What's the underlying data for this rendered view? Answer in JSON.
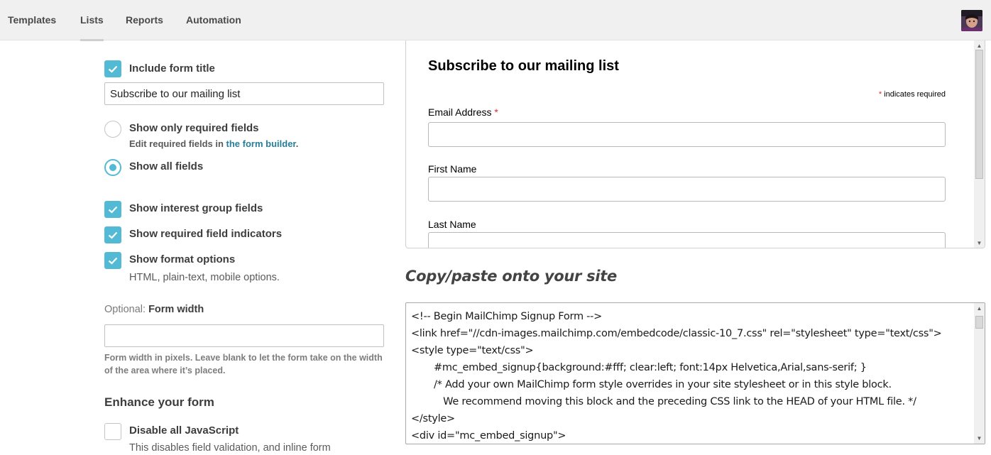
{
  "nav": {
    "tabs": [
      "Templates",
      "Lists",
      "Reports",
      "Automation"
    ],
    "active_tab": "Lists"
  },
  "left": {
    "include_form_title": {
      "label": "Include form title",
      "checked": true,
      "value": "Subscribe to our mailing list"
    },
    "required_only": {
      "label": "Show only required fields",
      "selected": false,
      "help_prefix": "Edit required fields in ",
      "help_link": "the form builder",
      "help_suffix": "."
    },
    "all_fields": {
      "label": "Show all fields",
      "selected": true
    },
    "interest_groups": {
      "label": "Show interest group fields",
      "checked": true
    },
    "required_indicators": {
      "label": "Show required field indicators",
      "checked": true
    },
    "format_options": {
      "label": "Show format options",
      "checked": true,
      "sub": "HTML, plain-text, mobile options."
    },
    "form_width": {
      "prefix": "Optional: ",
      "label": "Form width",
      "value": "",
      "help": "Form width in pixels. Leave blank to let the form take on the width of the area where it’s placed."
    },
    "enhance": {
      "heading": "Enhance your form"
    },
    "disable_js": {
      "label": "Disable all JavaScript",
      "checked": false,
      "sub": "This disables field validation, and inline form"
    }
  },
  "preview": {
    "title": "Subscribe to our mailing list",
    "required_note": "indicates required",
    "asterisk": "*",
    "fields": [
      "Email Address",
      "First Name",
      "Last Name"
    ]
  },
  "embed": {
    "heading": "Copy/paste onto your site",
    "lines": [
      "<!-- Begin MailChimp Signup Form -->",
      "<link href=\"//cdn-images.mailchimp.com/embedcode/classic-10_7.css\" rel=\"stylesheet\" type=\"text/css\">",
      "<style type=\"text/css\">",
      "\t#mc_embed_signup{background:#fff; clear:left; font:14px Helvetica,Arial,sans-serif; }",
      "\t/* Add your own MailChimp form style overrides in your site stylesheet or in this style block.",
      "\t   We recommend moving this block and the preceding CSS link to the HEAD of your HTML file. */",
      "</style>",
      "<div id=\"mc_embed_signup\">"
    ]
  },
  "colors": {
    "accent": "#52bad5",
    "link": "#267e99",
    "nav_bg": "#f0f0f0"
  }
}
